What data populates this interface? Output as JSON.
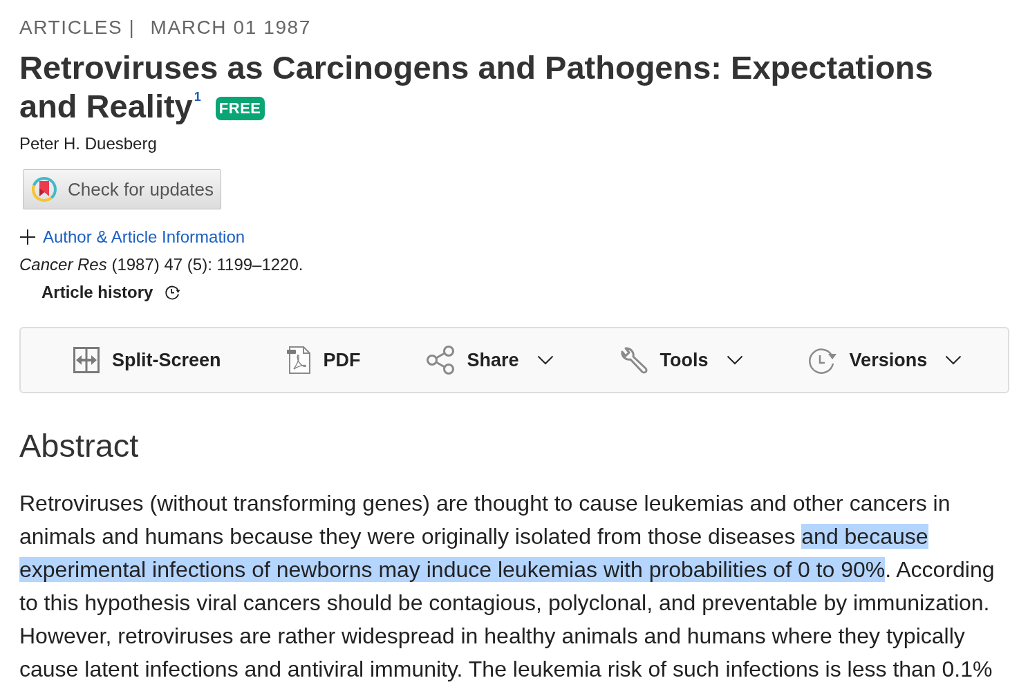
{
  "breadcrumb": {
    "category": "ARTICLES |",
    "date": "MARCH 01 1987"
  },
  "article": {
    "title": "Retroviruses as Carcinogens and Pathogens: Expectations and Reality",
    "footnote": "1",
    "badge": "FREE",
    "author": "Peter H. Duesberg",
    "updates_button": "Check for updates",
    "info_link": {
      "label": "Author & Article Information",
      "expanded": false
    },
    "citation": "*Cancer Res* (1987) 47 (5): 1199–1220.",
    "history": "Article history"
  },
  "toolbar": [
    {
      "label": "Split-Screen",
      "has_menu": false
    },
    {
      "label": "PDF",
      "has_menu": false
    },
    {
      "label": "Share",
      "has_menu": true
    },
    {
      "label": "Tools",
      "has_menu": true
    },
    {
      "label": "Versions",
      "has_menu": true
    }
  ],
  "abstract": {
    "heading": "Abstract",
    "segments": [
      {
        "text": "Retroviruses (without transforming genes) are thought to cause leukemias and other cancers in animals and humans because they were originally isolated from those diseases ",
        "selected": false
      },
      {
        "text": "and because experimental infections of newborns may induce leukemias with probabilities of 0 to 90%",
        "selected": true
      },
      {
        "text": ". According to this hypothesis viral cancers should be contagious, polyclonal, and preventable by immunization. However, retroviruses are rather widespread in healthy animals and humans where they typically cause latent infections and antiviral immunity. The leukemia risk of such infections is less than 0.1%",
        "selected": false
      }
    ]
  }
}
